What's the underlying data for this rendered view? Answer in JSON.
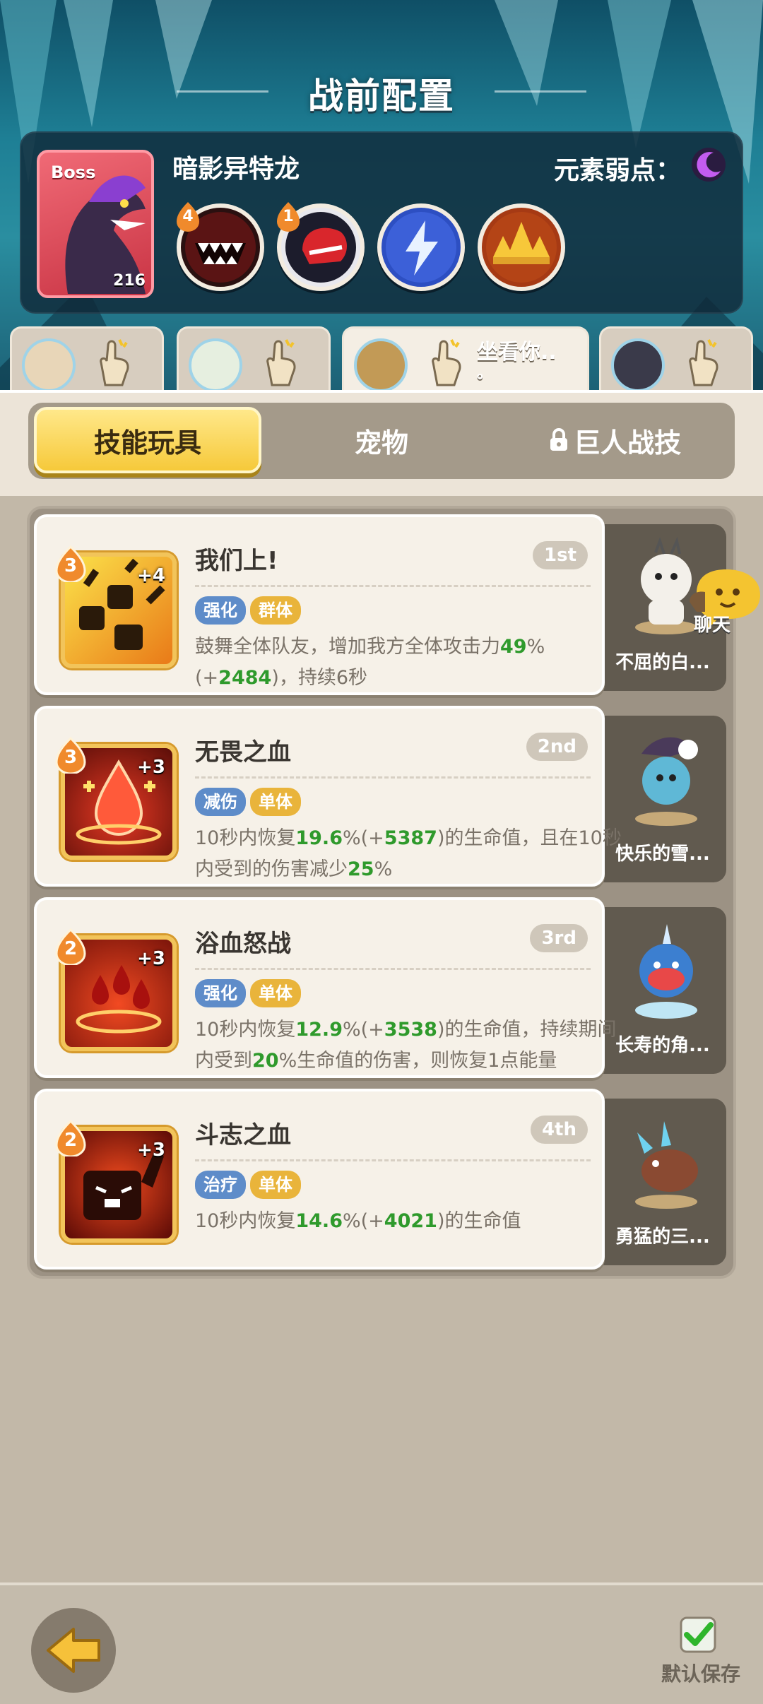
{
  "header": {
    "title": "战前配置"
  },
  "boss": {
    "tag": "Boss",
    "name": "暗影异特龙",
    "level": "216",
    "weakness_label": "元素弱点：",
    "weakness_icon": "moon-icon",
    "skills": [
      {
        "icon": "fang-mouth-icon",
        "badge": "4"
      },
      {
        "icon": "red-fist-icon",
        "badge": "1"
      },
      {
        "icon": "lightning-icon",
        "badge": ""
      },
      {
        "icon": "golden-crown-spikes-icon",
        "badge": ""
      }
    ]
  },
  "team_tabs": [
    {
      "icon": "pet-avatar-1"
    },
    {
      "icon": "pet-avatar-2"
    },
    {
      "icon": "pet-avatar-3",
      "label": "坐看你..",
      "label2": "。"
    },
    {
      "icon": "pet-avatar-4"
    }
  ],
  "categories": [
    {
      "label": "技能玩具",
      "active": true
    },
    {
      "label": "宠物",
      "active": false
    },
    {
      "label": "巨人战技",
      "locked": true
    }
  ],
  "skills": [
    {
      "title": "我们上!",
      "rank": "1st",
      "level": "3",
      "plus": "+4",
      "tags": [
        "强化",
        "群体"
      ],
      "desc_parts": [
        "鼓舞全体队友，增加我方全体攻击力",
        "49",
        "%(+",
        "2484",
        ")，持续6秒"
      ],
      "pet_name": "不屈的白..."
    },
    {
      "title": "无畏之血",
      "rank": "2nd",
      "level": "3",
      "plus": "+3",
      "tags": [
        "减伤",
        "单体"
      ],
      "desc_parts": [
        "10秒内恢复",
        "19.6",
        "%(+",
        "5387",
        ")的生命值，且在10秒内受到的伤害减少",
        "25",
        "%"
      ],
      "pet_name": "快乐的雪..."
    },
    {
      "title": "浴血怒战",
      "rank": "3rd",
      "level": "2",
      "plus": "+3",
      "tags": [
        "强化",
        "单体"
      ],
      "desc_parts": [
        "10秒内恢复",
        "12.9",
        "%(+",
        "3538",
        ")的生命值，持续期间内受到",
        "20",
        "%生命值的伤害，则恢复1点能量"
      ],
      "pet_name": "长寿的角..."
    },
    {
      "title": "斗志之血",
      "rank": "4th",
      "level": "2",
      "plus": "+3",
      "tags": [
        "治疗",
        "单体"
      ],
      "desc_parts": [
        "10秒内恢复",
        "14.6",
        "%(+",
        "4021",
        ")的生命值"
      ],
      "pet_name": "勇猛的三..."
    }
  ],
  "chat": {
    "label": "聊天"
  },
  "footer": {
    "save_label": "默认保存"
  }
}
